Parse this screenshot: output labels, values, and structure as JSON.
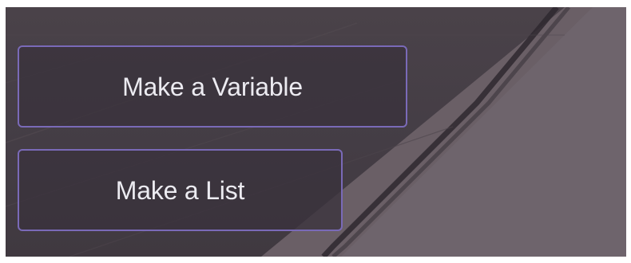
{
  "colors": {
    "background": "#443d45",
    "button_border": "#7a6ab8",
    "button_text": "#ecebf1"
  },
  "buttons": {
    "make_variable_label": "Make a Variable",
    "make_list_label": "Make a List"
  }
}
